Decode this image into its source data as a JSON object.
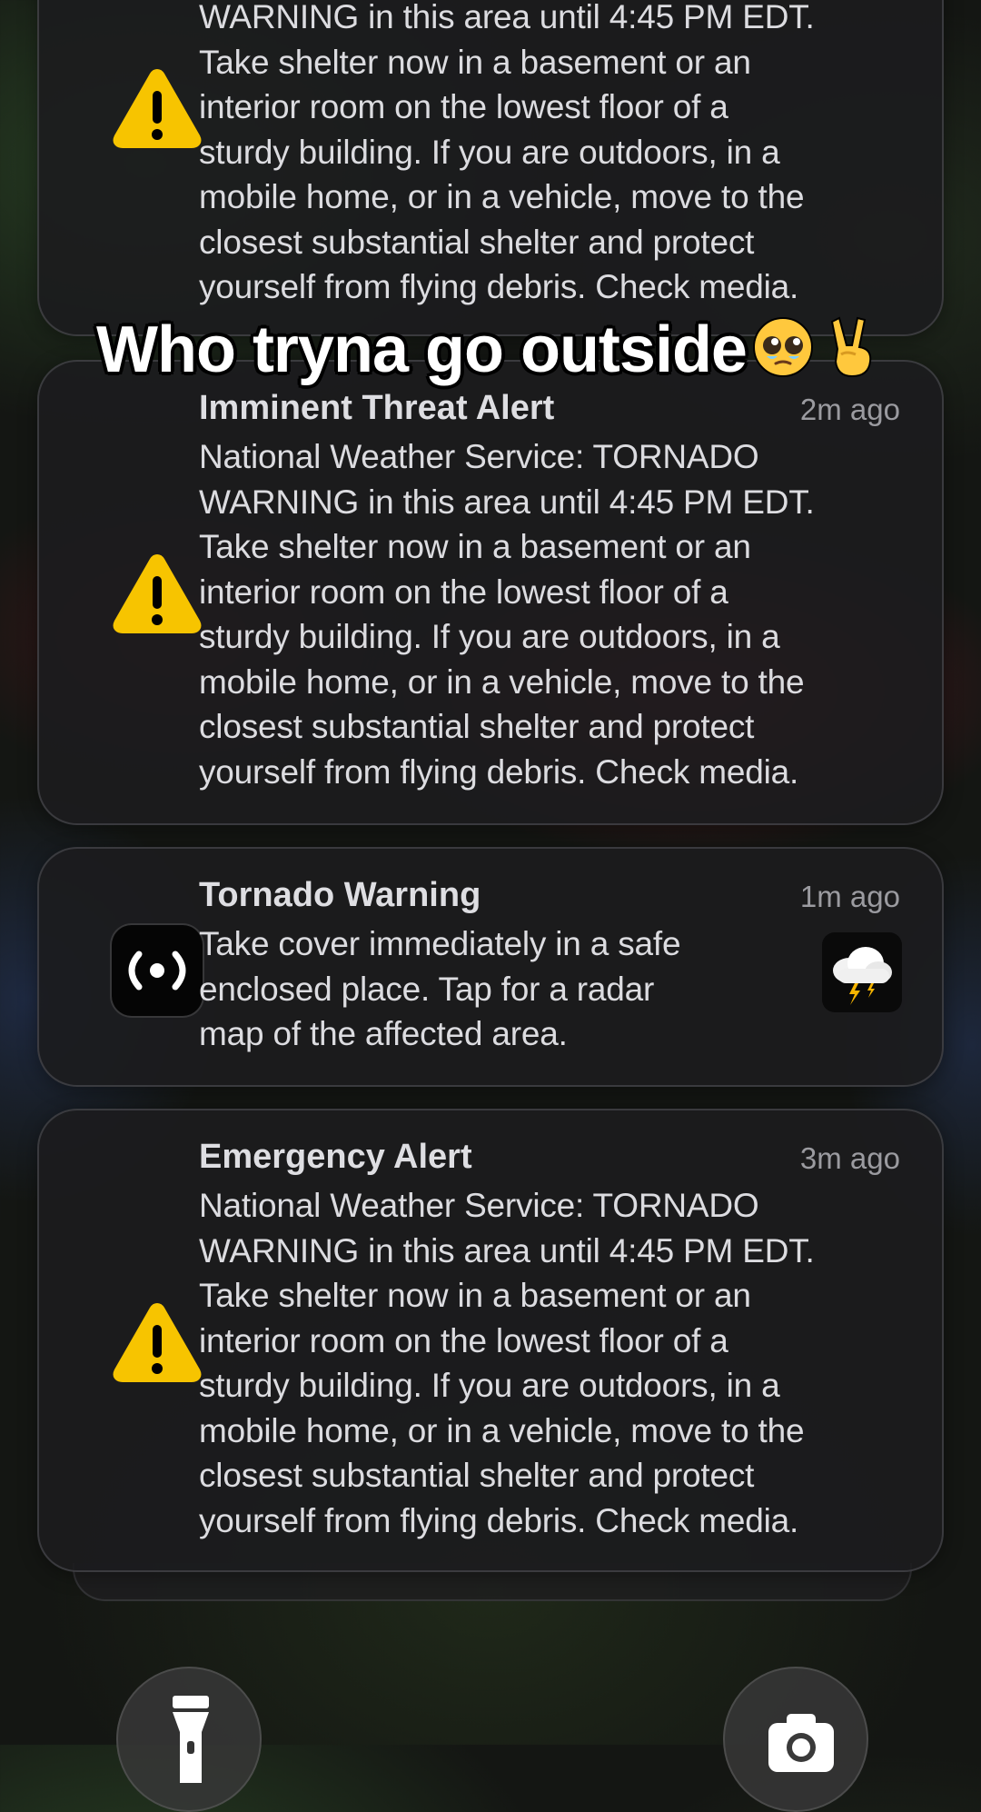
{
  "caption": {
    "text": "Who tryna go outside",
    "emojis": [
      "pleading-face-emoji",
      "victory-hand-emoji"
    ]
  },
  "colors": {
    "warning_yellow": "#F7C400",
    "card_bg": "#1C1C1E",
    "text_primary": "#DEDEE2",
    "text_secondary": "#9B9BA0"
  },
  "notifications": [
    {
      "icon": "warning-triangle-icon",
      "title": "",
      "time": "",
      "lines": [
        "WARNING in this area until 4:45 PM EDT.",
        "Take shelter now in a basement or an",
        "interior room on the lowest floor of a",
        "sturdy building. If you are outdoors, in a",
        "mobile home, or in a vehicle, move to the",
        "closest substantial shelter and protect",
        "yourself from flying debris. Check media."
      ]
    },
    {
      "icon": "warning-triangle-icon",
      "title": "Imminent Threat Alert",
      "time": "2m ago",
      "lines": [
        "National Weather Service: TORNADO",
        "WARNING in this area until 4:45 PM EDT.",
        "Take shelter now in a basement or an",
        "interior room on the lowest floor of a",
        "sturdy building. If you are outdoors, in a",
        "mobile home, or in a vehicle, move to the",
        "closest substantial shelter and protect",
        "yourself from flying debris. Check media."
      ]
    },
    {
      "icon": "broadcast-app-icon",
      "thumbnail": "thunderstorm-cloud-icon",
      "title": "Tornado Warning",
      "time": "1m ago",
      "lines": [
        "Take cover immediately in a safe",
        "enclosed place. Tap for a radar",
        "map of the affected area."
      ]
    },
    {
      "icon": "warning-triangle-icon",
      "title": "Emergency Alert",
      "time": "3m ago",
      "lines": [
        "National Weather Service: TORNADO",
        "WARNING in this area until 4:45 PM EDT.",
        "Take shelter now in a basement or an",
        "interior room on the lowest floor of a",
        "sturdy building. If you are outdoors, in a",
        "mobile home, or in a vehicle, move to the",
        "closest substantial shelter and protect",
        "yourself from flying debris. Check media."
      ]
    }
  ],
  "bottom_controls": [
    "flashlight-icon",
    "camera-icon"
  ]
}
